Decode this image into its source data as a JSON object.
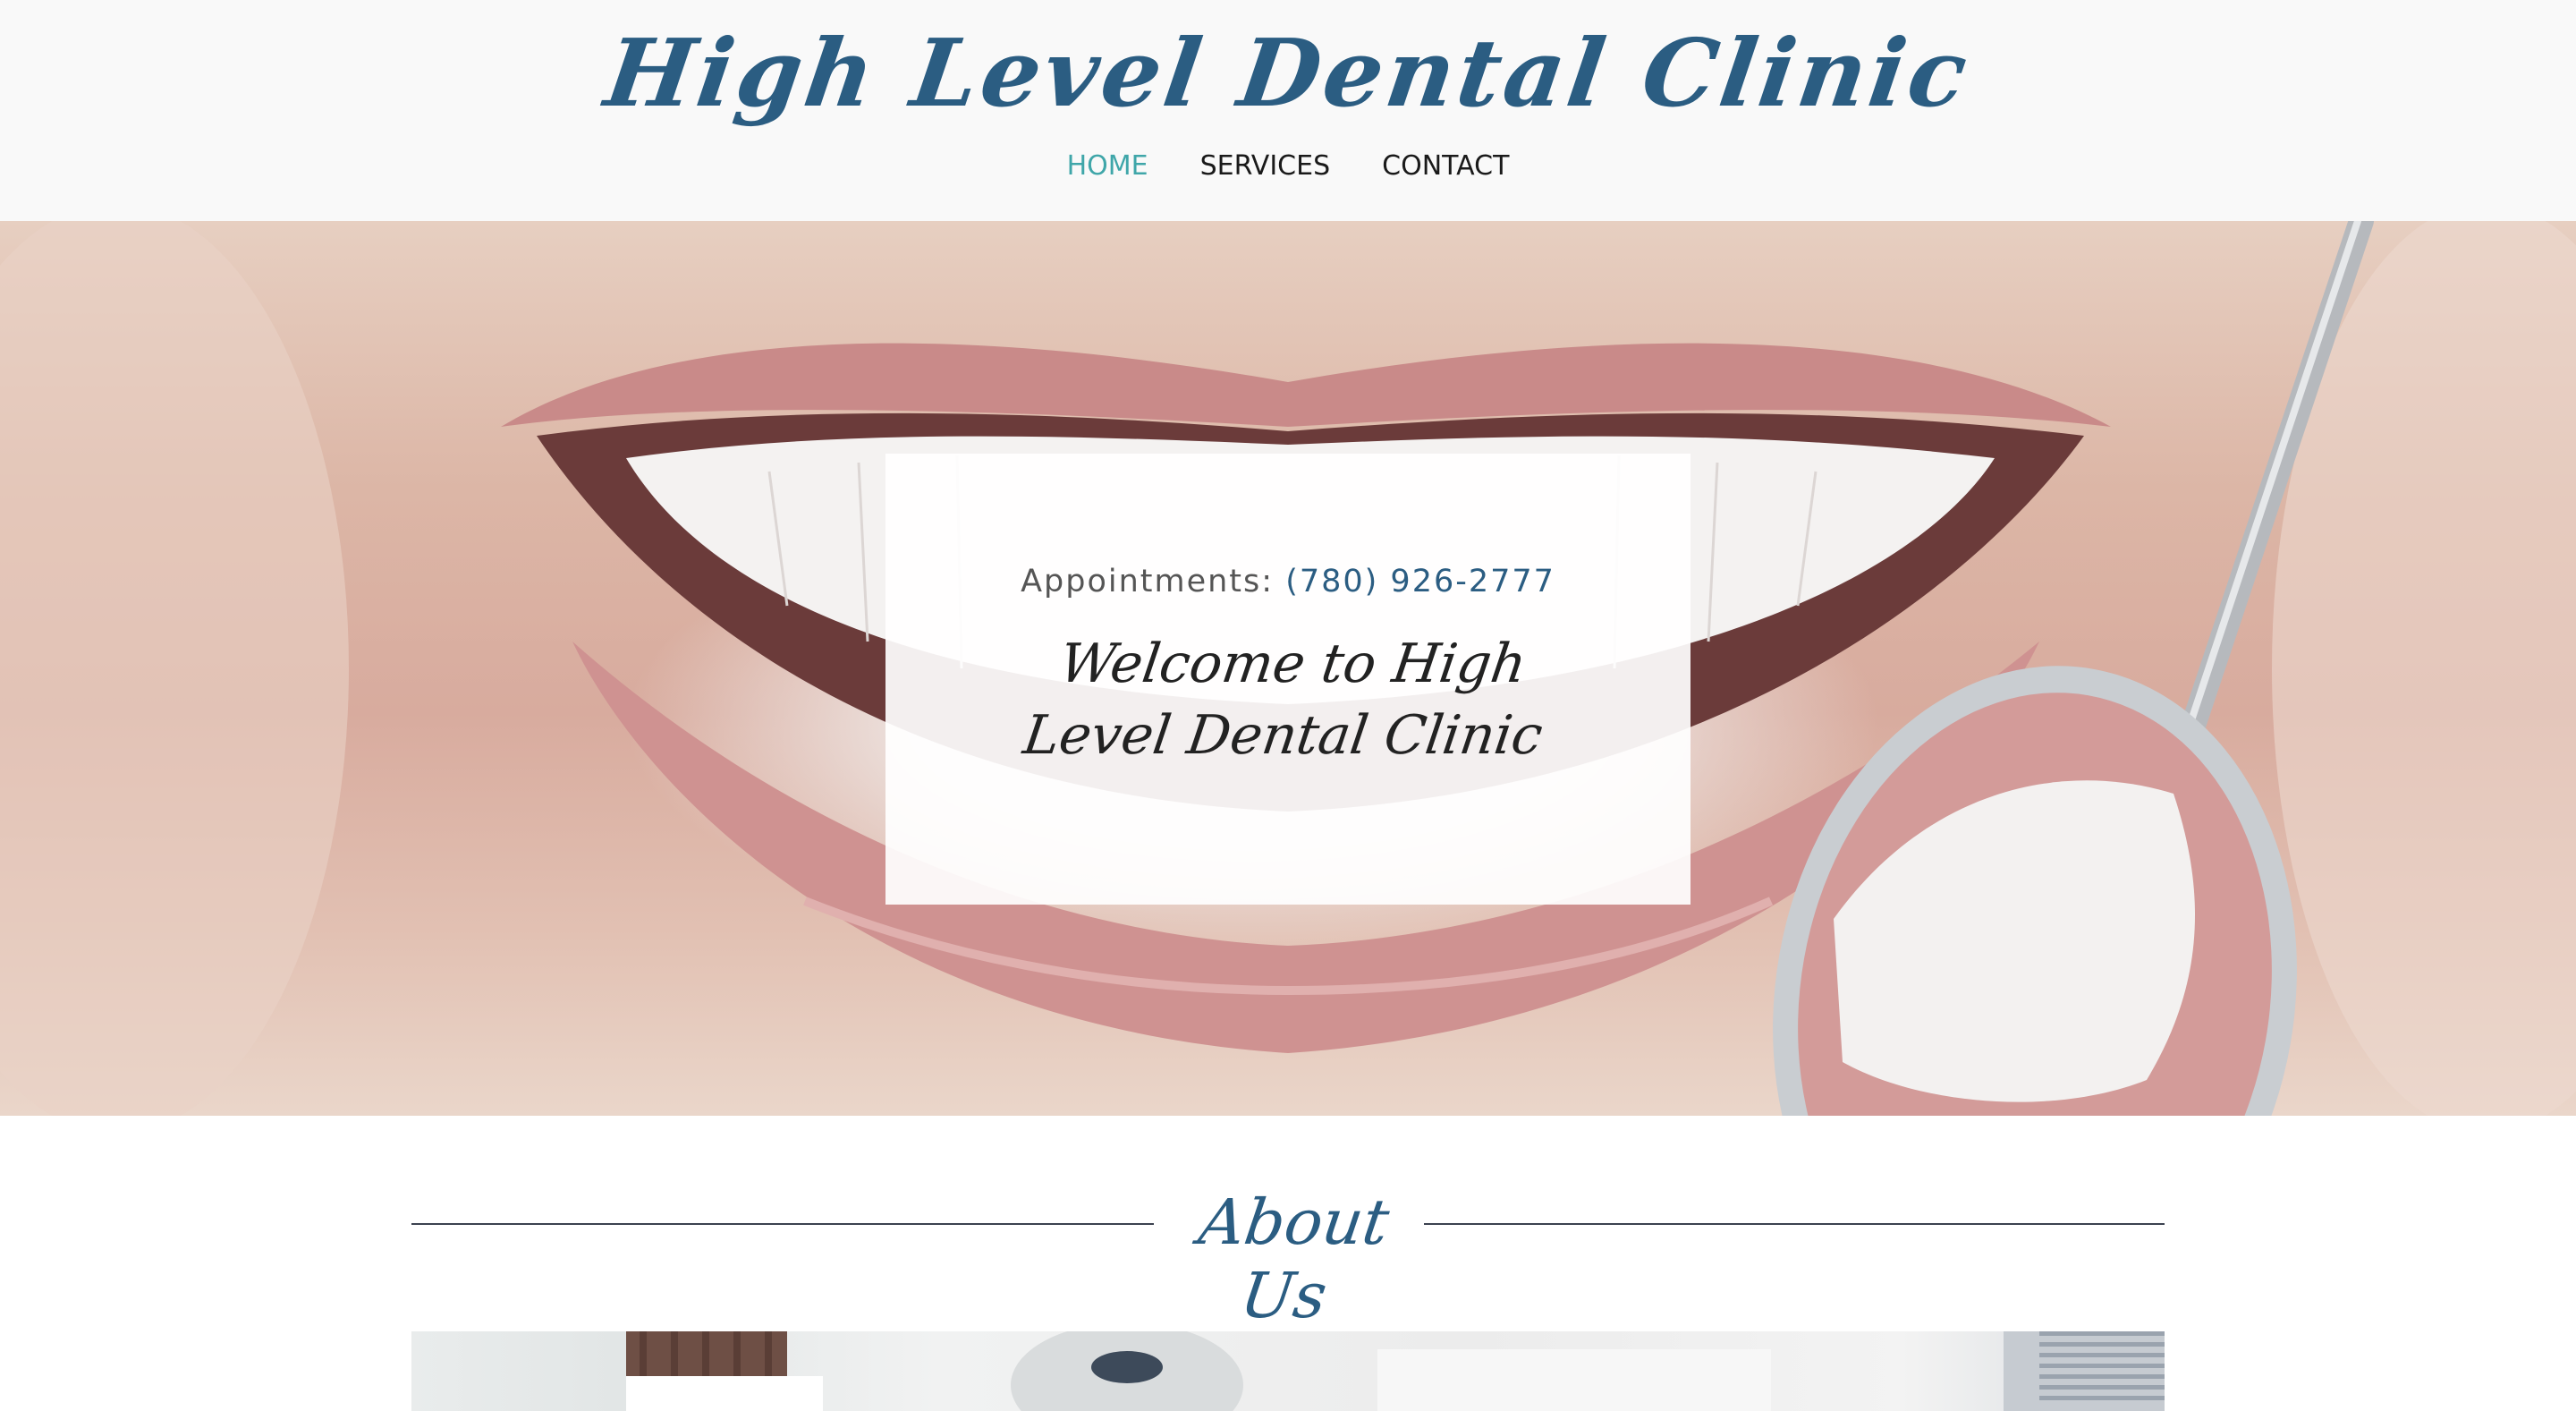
{
  "header": {
    "site_title": "High Level Dental Clinic",
    "nav": [
      {
        "label": "HOME",
        "active": true
      },
      {
        "label": "SERVICES",
        "active": false
      },
      {
        "label": "CONTACT",
        "active": false
      }
    ]
  },
  "hero": {
    "appointments_label": "Appointments:",
    "appointments_phone": "(780) 926-2777",
    "welcome_line1": "Welcome to High",
    "welcome_line2": "Level Dental Clinic"
  },
  "about": {
    "title": "About Us"
  },
  "colors": {
    "brand_blue": "#2b5d82",
    "nav_active": "#3fa6a9",
    "header_bg": "#f9f9f9"
  }
}
